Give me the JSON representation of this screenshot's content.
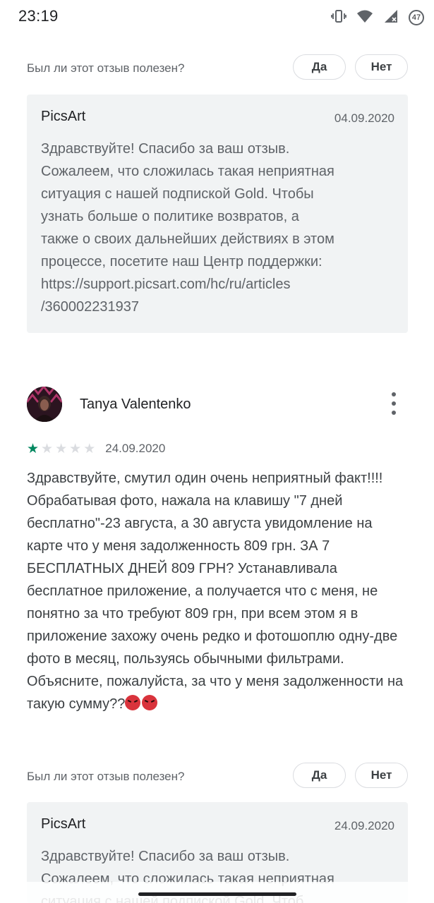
{
  "status_bar": {
    "time": "23:19",
    "battery_level": "47",
    "icons": [
      "vibrate-icon",
      "wifi-icon",
      "signal-icon",
      "battery-icon"
    ]
  },
  "helpful_1": {
    "question": "Был ли этот отзыв полезен?",
    "yes_label": "Да",
    "no_label": "Нет"
  },
  "dev_reply_1": {
    "developer": "PicsArt",
    "date": "04.09.2020",
    "text": "Здравствуйте! Спасибо за ваш отзыв.\nСожалеем, что сложилась такая неприятная\nситуация с нашей подпиской Gold. Чтобы\nузнать больше о политике возвратов, а\nтакже о своих дальнейших действиях в этом\nпроцессе, посетите наш Центр поддержки:\nhttps://support.picsart.com/hc/ru/articles\n/360002231937"
  },
  "review": {
    "author": "Tanya Valentenko",
    "rating": 1,
    "max_rating": 5,
    "date": "24.09.2020",
    "text": "Здравствуйте, смутил один очень неприятный факт!!!! Обрабатывая фото, нажала на клавишу \"7 дней бесплатно\"-23 августа, а 30 августа увидомление на карте что у меня задолженность 809 грн. ЗА 7 БЕСПЛАТНЫХ ДНЕЙ 809 ГРН? Устанавливала бесплатное приложение, а получается что с меня, не понятно за что требуют 809 грн, при всем этом я в приложение захожу очень редко и фотошоплю одну-две фото в месяц, пользуясь обычными фильтрами. Объясните, пожалуйста, за что у меня задолженности на такую сумму??",
    "emojis": [
      "angry-face-emoji",
      "angry-face-emoji"
    ],
    "avatar": "avatar"
  },
  "helpful_2": {
    "question": "Был ли этот отзыв полезен?",
    "yes_label": "Да",
    "no_label": "Нет"
  },
  "dev_reply_2": {
    "developer": "PicsArt",
    "date": "24.09.2020",
    "text": "Здравствуйте! Спасибо за ваш отзыв.\nСожалеем, что сложилась такая неприятная\nситуация с нашей подпиской Gold. Чтоб"
  },
  "colors": {
    "accent_star": "#01875f",
    "reply_background": "#f1f3f4",
    "secondary_text": "#5f6368"
  }
}
